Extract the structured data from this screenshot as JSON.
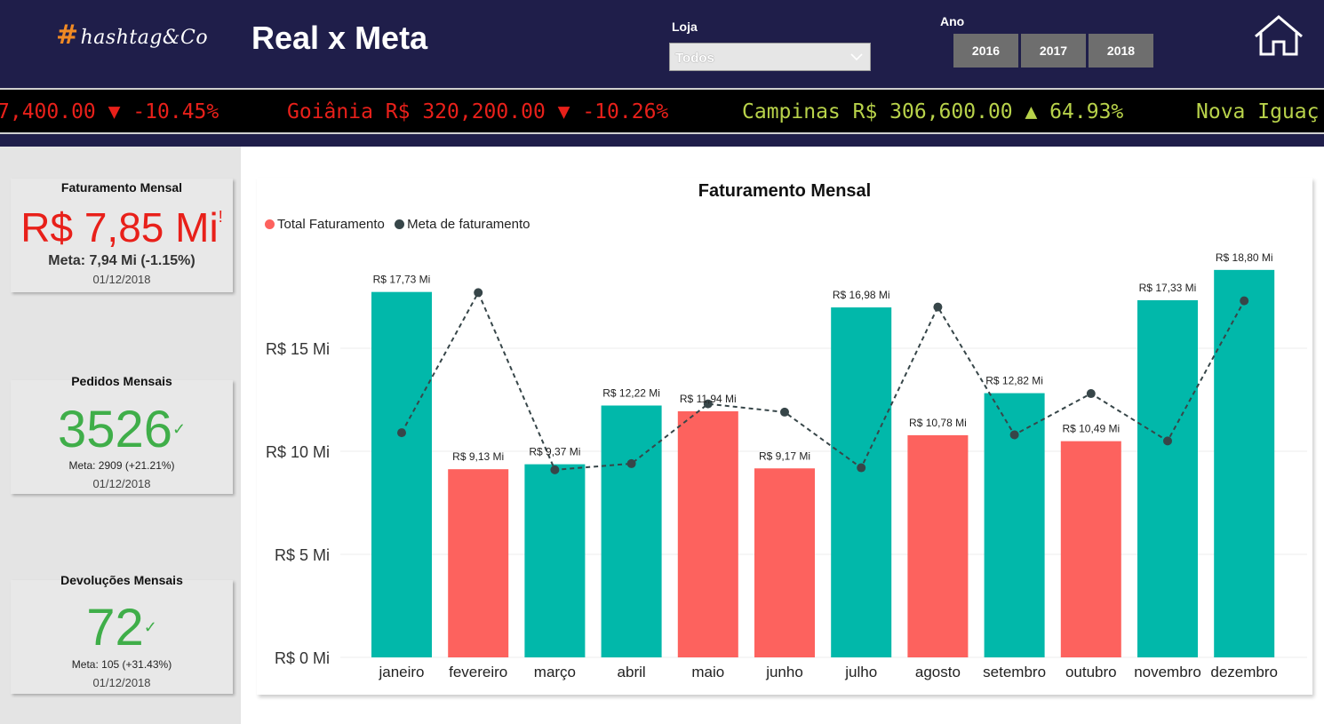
{
  "header": {
    "logo_hash": "#",
    "logo_text": "hashtag&Co",
    "title": "Real x Meta",
    "loja_label": "Loja",
    "loja_value": "Todos",
    "ano_label": "Ano",
    "years": [
      "2016",
      "2017",
      "2018"
    ]
  },
  "ticker": [
    {
      "text": "7,400.00 ▼ -10.45%",
      "color": "#e8201a"
    },
    {
      "text": "Goiânia R$ 320,200.00 ▼ -10.26%",
      "color": "#e8201a"
    },
    {
      "text": "Campinas R$ 306,600.00 ▲ 64.93%",
      "color": "#b8d24a"
    },
    {
      "text": "Nova Iguaç",
      "color": "#b8d24a"
    }
  ],
  "cards": {
    "faturamento": {
      "title": "Faturamento Mensal",
      "value": "R$ 7,85 Mi",
      "flag": "!",
      "meta": "Meta: 7,94 Mi (-1.15%)",
      "date": "01/12/2018",
      "color": "#e8201a"
    },
    "pedidos": {
      "title": "Pedidos Mensais",
      "value": "3526",
      "flag": "✓",
      "meta": "Meta: 2909 (+21.21%)",
      "date": "01/12/2018",
      "color": "#3fae49"
    },
    "devolucoes": {
      "title": "Devoluções Mensais",
      "value": "72",
      "flag": "✓",
      "meta": "Meta: 105 (+31.43%)",
      "date": "01/12/2018",
      "color": "#3fae49"
    }
  },
  "colors": {
    "above": "#01b8aa",
    "below": "#fd625e",
    "meta": "#374649"
  },
  "chart_data": {
    "type": "bar",
    "title": "Faturamento Mensal",
    "legend": [
      "Total Faturamento",
      "Meta de faturamento"
    ],
    "legend_colors": [
      "#fd625e",
      "#374649"
    ],
    "categories": [
      "janeiro",
      "fevereiro",
      "março",
      "abril",
      "maio",
      "junho",
      "julho",
      "agosto",
      "setembro",
      "outubro",
      "novembro",
      "dezembro"
    ],
    "series": [
      {
        "name": "Total Faturamento",
        "values": [
          17.73,
          9.13,
          9.37,
          12.22,
          11.94,
          9.17,
          16.98,
          10.78,
          12.82,
          10.49,
          17.33,
          18.8
        ],
        "labels": [
          "R$ 17,73 Mi",
          "R$ 9,13 Mi",
          "R$ 9,37 Mi",
          "R$ 12,22 Mi",
          "R$ 11,94 Mi",
          "R$ 9,17 Mi",
          "R$ 16,98 Mi",
          "R$ 10,78 Mi",
          "R$ 12,82 Mi",
          "R$ 10,49 Mi",
          "R$ 17,33 Mi",
          "R$ 18,80 Mi"
        ],
        "above_meta": [
          true,
          false,
          true,
          true,
          false,
          false,
          true,
          false,
          true,
          false,
          true,
          true
        ]
      },
      {
        "name": "Meta de faturamento",
        "values": [
          10.9,
          17.7,
          9.1,
          9.4,
          12.3,
          11.9,
          9.2,
          17.0,
          10.8,
          12.8,
          10.5,
          17.3
        ]
      }
    ],
    "yticks": [
      "R$ 0 Mi",
      "R$ 5 Mi",
      "R$ 10 Mi",
      "R$ 15 Mi"
    ],
    "ytick_values": [
      0,
      5,
      10,
      15
    ],
    "ylim": [
      0,
      19.5
    ],
    "grid": true,
    "legend_position": "top-left"
  }
}
